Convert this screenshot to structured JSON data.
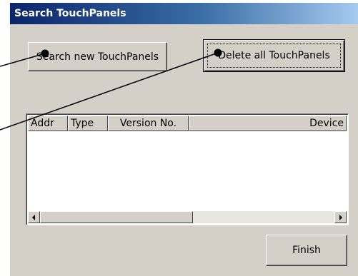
{
  "window": {
    "title": "Search TouchPanels"
  },
  "buttons": {
    "search": "Search new TouchPanels",
    "delete_all": "Delete all TouchPanels",
    "finish": "Finish"
  },
  "list": {
    "columns": [
      "Addr",
      "Type",
      "Version No.",
      "Device"
    ],
    "rows": []
  },
  "icons": {
    "scroll_left": "left-arrow",
    "scroll_right": "right-arrow"
  }
}
